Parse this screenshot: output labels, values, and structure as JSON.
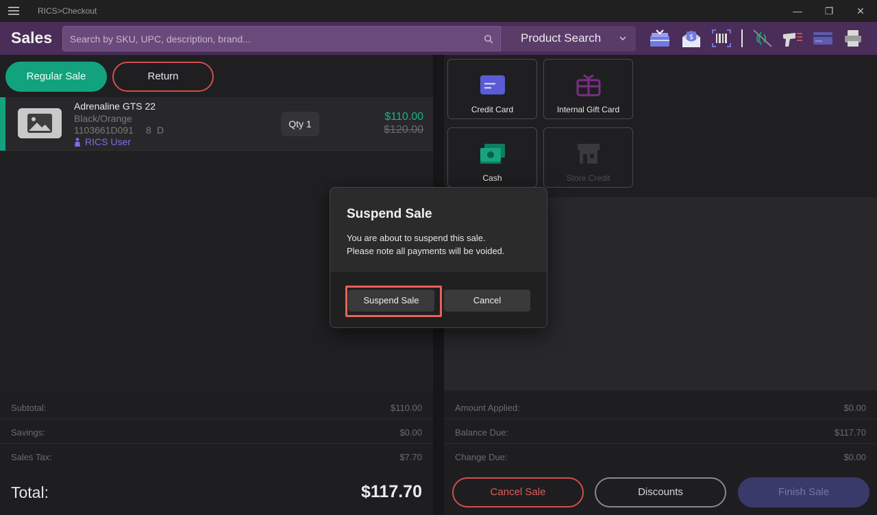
{
  "window": {
    "title": "RICS>Checkout",
    "minimize": "—",
    "restore": "❐",
    "close": "✕"
  },
  "header": {
    "brand": "Sales",
    "search_placeholder": "Search by SKU, UPC, description, brand...",
    "product_search_label": "Product Search"
  },
  "modes": {
    "regular_label": "Regular Sale",
    "return_label": "Return"
  },
  "cart": {
    "items": [
      {
        "name": "Adrenaline GTS 22",
        "color": "Black/Orange",
        "sku": "1103661D091",
        "size": "8",
        "width": "D",
        "user": "RICS User",
        "qty_label": "Qty 1",
        "price": "$110.00",
        "original_price": "$120.00"
      }
    ]
  },
  "totals_left": {
    "subtotal_label": "Subtotal:",
    "subtotal_value": "$110.00",
    "savings_label": "Savings:",
    "savings_value": "$0.00",
    "tax_label": "Sales Tax:",
    "tax_value": "$7.70",
    "total_label": "Total:",
    "total_value": "$117.70"
  },
  "payments": {
    "credit_card": "Credit Card",
    "gift_card": "Internal Gift Card",
    "cash": "Cash",
    "store_credit": "Store Credit"
  },
  "totals_right": {
    "applied_label": "Amount Applied:",
    "applied_value": "$0.00",
    "balance_label": "Balance Due:",
    "balance_value": "$117.70",
    "change_label": "Change Due:",
    "change_value": "$0.00"
  },
  "actions": {
    "cancel_sale": "Cancel Sale",
    "discounts": "Discounts",
    "finish_sale": "Finish Sale"
  },
  "dialog": {
    "title": "Suspend Sale",
    "message_line1": "You are about to suspend this sale.",
    "message_line2": "Please note all payments will be voided.",
    "confirm_label": "Suspend Sale",
    "cancel_label": "Cancel"
  },
  "colors": {
    "accent_green": "#12a37e",
    "header_purple": "#4a2d58",
    "danger_red": "#d24e4e",
    "highlight": "#e8625b"
  }
}
